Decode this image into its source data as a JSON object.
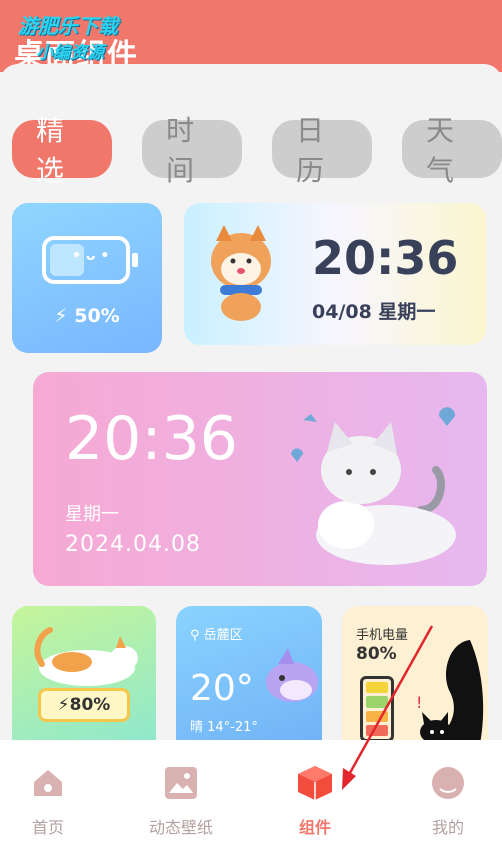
{
  "header": {
    "title": "桌面组件",
    "watermark_line1": "游肥乐下载",
    "watermark_line2": "小编资源"
  },
  "tabs": [
    {
      "label": "精选",
      "active": true
    },
    {
      "label": "时间",
      "active": false
    },
    {
      "label": "日历",
      "active": false
    },
    {
      "label": "天气",
      "active": false
    }
  ],
  "widgets": {
    "battery": {
      "percent": "50%"
    },
    "clock1": {
      "time": "20:36",
      "date": "04/08  星期一"
    },
    "clock2": {
      "time": "20:36",
      "weekday": "星期一",
      "date": "2024.04.08"
    },
    "battery_cat": {
      "percent": "80%"
    },
    "weather": {
      "location": "岳麓区",
      "temp": "20°",
      "range": "晴 14°-21°"
    },
    "phone_battery": {
      "label": "手机电量",
      "percent": "80%"
    }
  },
  "bottom_nav": [
    {
      "label": "首页",
      "icon": "home-icon"
    },
    {
      "label": "动态壁纸",
      "icon": "wallpaper-icon"
    },
    {
      "label": "组件",
      "icon": "widget-cube-icon",
      "active": true
    },
    {
      "label": "我的",
      "icon": "profile-icon"
    }
  ],
  "colors": {
    "accent": "#f2776b",
    "inactive_tab": "#cdcdcd",
    "nav_inactive": "#b4a0a0"
  }
}
